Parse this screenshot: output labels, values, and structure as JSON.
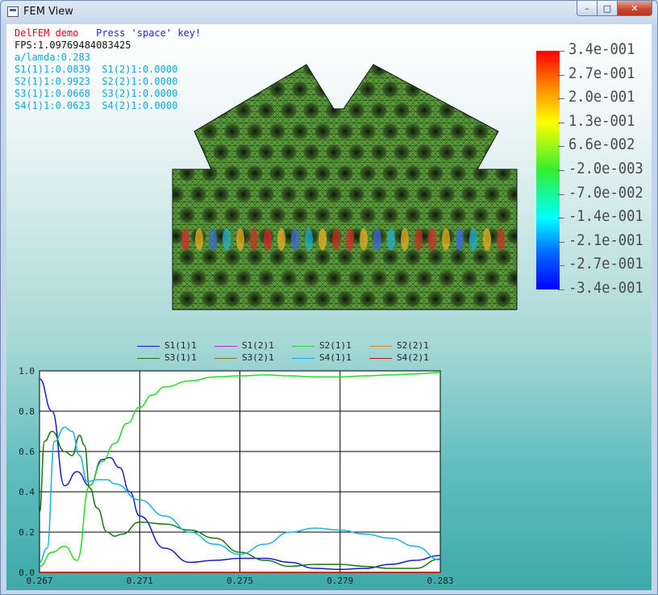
{
  "window": {
    "title": "FEM View",
    "buttons": {
      "minimize": "–",
      "maximize": "□",
      "close": "✕"
    }
  },
  "info": {
    "demo_label": "DelFEM demo",
    "press_label": "Press 'space' key!",
    "fps": "FPS:1.09769484083425",
    "ratio": "a/lamda:0.283",
    "rows": [
      "S1(1)1:0.0839  S1(2)1:0.0000",
      "S2(1)1:0.9923  S2(2)1:0.0000",
      "S3(1)1:0.0668  S3(2)1:0.0000",
      "S4(1)1:0.0623  S4(2)1:0.0000"
    ]
  },
  "colors": {
    "demo": "#e4001c",
    "press": "#1c2bd6",
    "fps": "#111111",
    "info": "#0fa8d6"
  },
  "colorbar": {
    "labels": [
      "3.4e-001",
      "2.7e-001",
      "2.0e-001",
      "1.3e-001",
      "6.6e-002",
      "-2.0e-003",
      "-7.0e-002",
      "-1.4e-001",
      "-2.1e-001",
      "-2.7e-001",
      "-3.4e-001"
    ]
  },
  "chart_data": {
    "type": "line",
    "xlim": [
      0.267,
      0.283
    ],
    "ylim": [
      0.0,
      1.0
    ],
    "x_ticks": [
      "0.267",
      "0.271",
      "0.275",
      "0.279",
      "0.283"
    ],
    "y_ticks": [
      "0.0",
      "0.2",
      "0.4",
      "0.6",
      "0.8",
      "1.0"
    ],
    "grid": true,
    "legend": "top",
    "series": [
      {
        "name": "S1(1)1",
        "color": "#1a1acc",
        "x": [
          0.267,
          0.2675,
          0.268,
          0.2685,
          0.269,
          0.2695,
          0.2698,
          0.2702,
          0.2706,
          0.271,
          0.272,
          0.273,
          0.274,
          0.275,
          0.276,
          0.277,
          0.278,
          0.279,
          0.28,
          0.281,
          0.282,
          0.283
        ],
        "y": [
          0.96,
          0.8,
          0.43,
          0.5,
          0.43,
          0.56,
          0.57,
          0.52,
          0.4,
          0.28,
          0.12,
          0.05,
          0.06,
          0.07,
          0.07,
          0.05,
          0.02,
          0.015,
          0.02,
          0.04,
          0.06,
          0.084
        ]
      },
      {
        "name": "S1(2)1",
        "color": "#cc22cc",
        "x": [
          0.267,
          0.283
        ],
        "y": [
          0.0,
          0.0
        ]
      },
      {
        "name": "S2(1)1",
        "color": "#22dd22",
        "x": [
          0.267,
          0.2675,
          0.268,
          0.2685,
          0.269,
          0.2695,
          0.27,
          0.2705,
          0.271,
          0.2715,
          0.272,
          0.273,
          0.274,
          0.275,
          0.276,
          0.277,
          0.278,
          0.279,
          0.28,
          0.281,
          0.282,
          0.283
        ],
        "y": [
          0.03,
          0.1,
          0.13,
          0.06,
          0.43,
          0.55,
          0.64,
          0.74,
          0.82,
          0.88,
          0.92,
          0.95,
          0.97,
          0.975,
          0.98,
          0.975,
          0.97,
          0.97,
          0.975,
          0.98,
          0.985,
          0.992
        ]
      },
      {
        "name": "S2(2)1",
        "color": "#e08a1a",
        "x": [
          0.267,
          0.283
        ],
        "y": [
          0.0,
          0.0
        ]
      },
      {
        "name": "S3(1)1",
        "color": "#137a13",
        "x": [
          0.267,
          0.2672,
          0.2675,
          0.268,
          0.2683,
          0.2686,
          0.2688,
          0.269,
          0.2693,
          0.2697,
          0.27,
          0.2703,
          0.271,
          0.272,
          0.273,
          0.274,
          0.275,
          0.276,
          0.277,
          0.278,
          0.279,
          0.28,
          0.281,
          0.282,
          0.283
        ],
        "y": [
          0.3,
          0.65,
          0.7,
          0.6,
          0.58,
          0.68,
          0.63,
          0.42,
          0.32,
          0.2,
          0.18,
          0.19,
          0.25,
          0.24,
          0.21,
          0.17,
          0.1,
          0.06,
          0.03,
          0.04,
          0.04,
          0.03,
          0.02,
          0.02,
          0.067
        ]
      },
      {
        "name": "S3(2)1",
        "color": "#8a7a1a",
        "x": [
          0.267,
          0.283
        ],
        "y": [
          0.0,
          0.0
        ]
      },
      {
        "name": "S4(1)1",
        "color": "#1ab2e0",
        "x": [
          0.267,
          0.2673,
          0.2676,
          0.268,
          0.2683,
          0.2686,
          0.2689,
          0.2693,
          0.2697,
          0.27,
          0.271,
          0.272,
          0.273,
          0.274,
          0.275,
          0.276,
          0.277,
          0.278,
          0.279,
          0.28,
          0.281,
          0.282,
          0.283
        ],
        "y": [
          0.05,
          0.12,
          0.65,
          0.72,
          0.7,
          0.58,
          0.45,
          0.46,
          0.46,
          0.44,
          0.36,
          0.28,
          0.2,
          0.14,
          0.09,
          0.14,
          0.2,
          0.22,
          0.21,
          0.19,
          0.17,
          0.13,
          0.062
        ]
      },
      {
        "name": "S4(2)1",
        "color": "#c01818",
        "x": [
          0.267,
          0.283
        ],
        "y": [
          0.0,
          0.0
        ]
      }
    ]
  }
}
